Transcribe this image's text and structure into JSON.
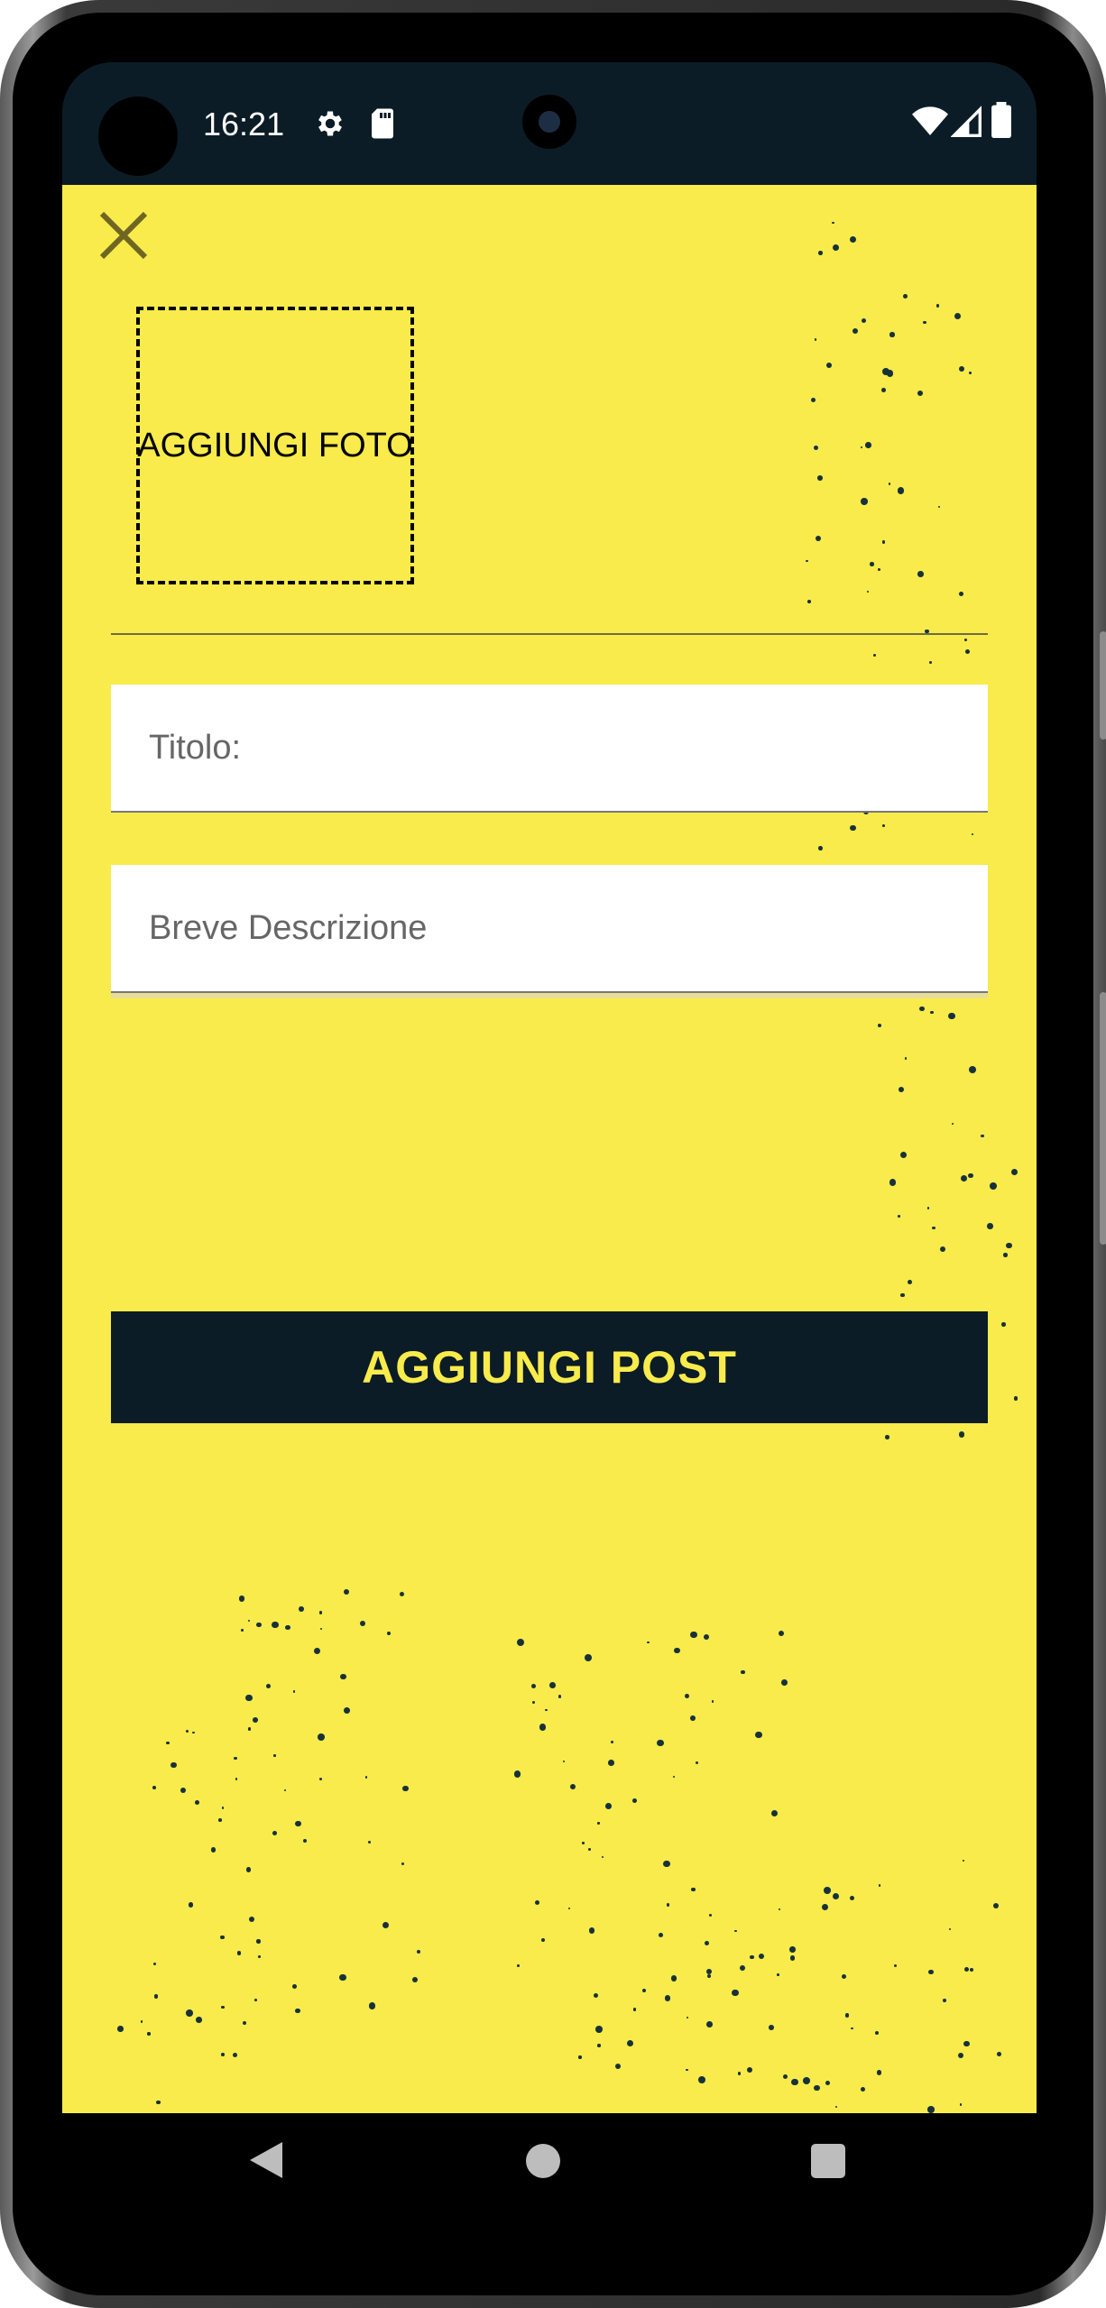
{
  "status_bar": {
    "time": "16:21",
    "icons": [
      "gear-icon",
      "sd-card-icon",
      "wifi-icon",
      "signal-icon",
      "battery-icon"
    ]
  },
  "toolbar": {
    "close_icon": "close-icon"
  },
  "photo_picker": {
    "label": "AGGIUNGI FOTO"
  },
  "form": {
    "title": {
      "placeholder": "Titolo:",
      "value": ""
    },
    "description": {
      "placeholder": "Breve Descrizione",
      "value": ""
    },
    "submit_label": "AGGIUNGI POST"
  },
  "nav_bar": {
    "icons": [
      "back-icon",
      "home-icon",
      "recents-icon"
    ]
  },
  "colors": {
    "background": "#f8eb4b",
    "dark": "#0b1c26",
    "accent_text": "#f8eb4b"
  }
}
